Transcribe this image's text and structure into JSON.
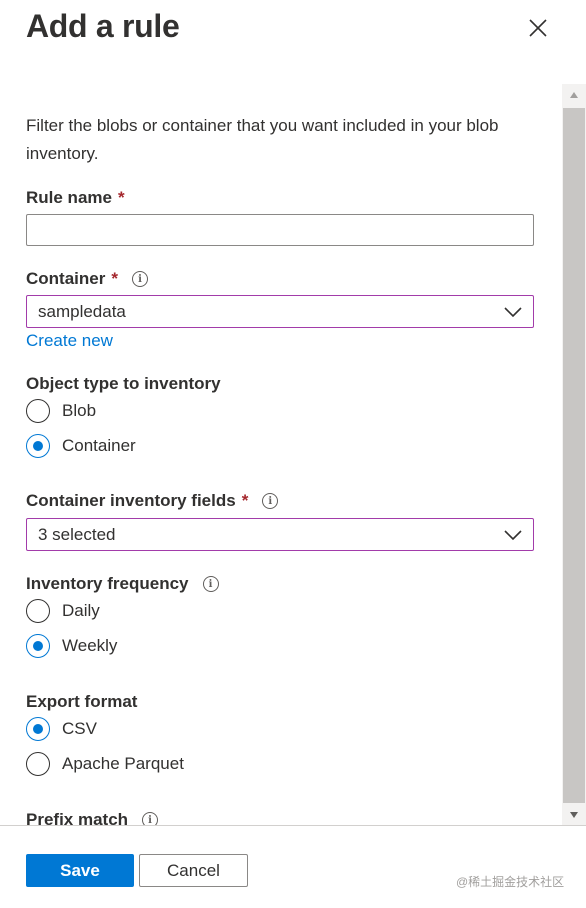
{
  "panel": {
    "title": "Add a rule",
    "close_icon": "close-icon"
  },
  "form": {
    "description": "Filter the blobs or container that you want included in your blob inventory.",
    "rule_name": {
      "label": "Rule name",
      "required_mark": "*",
      "value": ""
    },
    "container": {
      "label": "Container",
      "required_mark": "*",
      "info": "i",
      "selected": "sampledata",
      "create_link": "Create new"
    },
    "object_type": {
      "label": "Object type to inventory",
      "options": [
        "Blob",
        "Container"
      ],
      "selected": "Container"
    },
    "inventory_fields": {
      "label": "Container inventory fields",
      "required_mark": "*",
      "info": "i",
      "selected": "3 selected"
    },
    "frequency": {
      "label": "Inventory frequency",
      "info": "i",
      "options": [
        "Daily",
        "Weekly"
      ],
      "selected": "Weekly"
    },
    "export_format": {
      "label": "Export format",
      "options": [
        "CSV",
        "Apache Parquet"
      ],
      "selected": "CSV"
    },
    "prefix_match": {
      "label": "Prefix match",
      "info": "i"
    }
  },
  "footer": {
    "save_label": "Save",
    "cancel_label": "Cancel"
  },
  "watermark": "@稀土掘金技术社区",
  "colors": {
    "accent": "#0078d4",
    "required": "#a4262c",
    "focus_border": "#a23baa"
  }
}
